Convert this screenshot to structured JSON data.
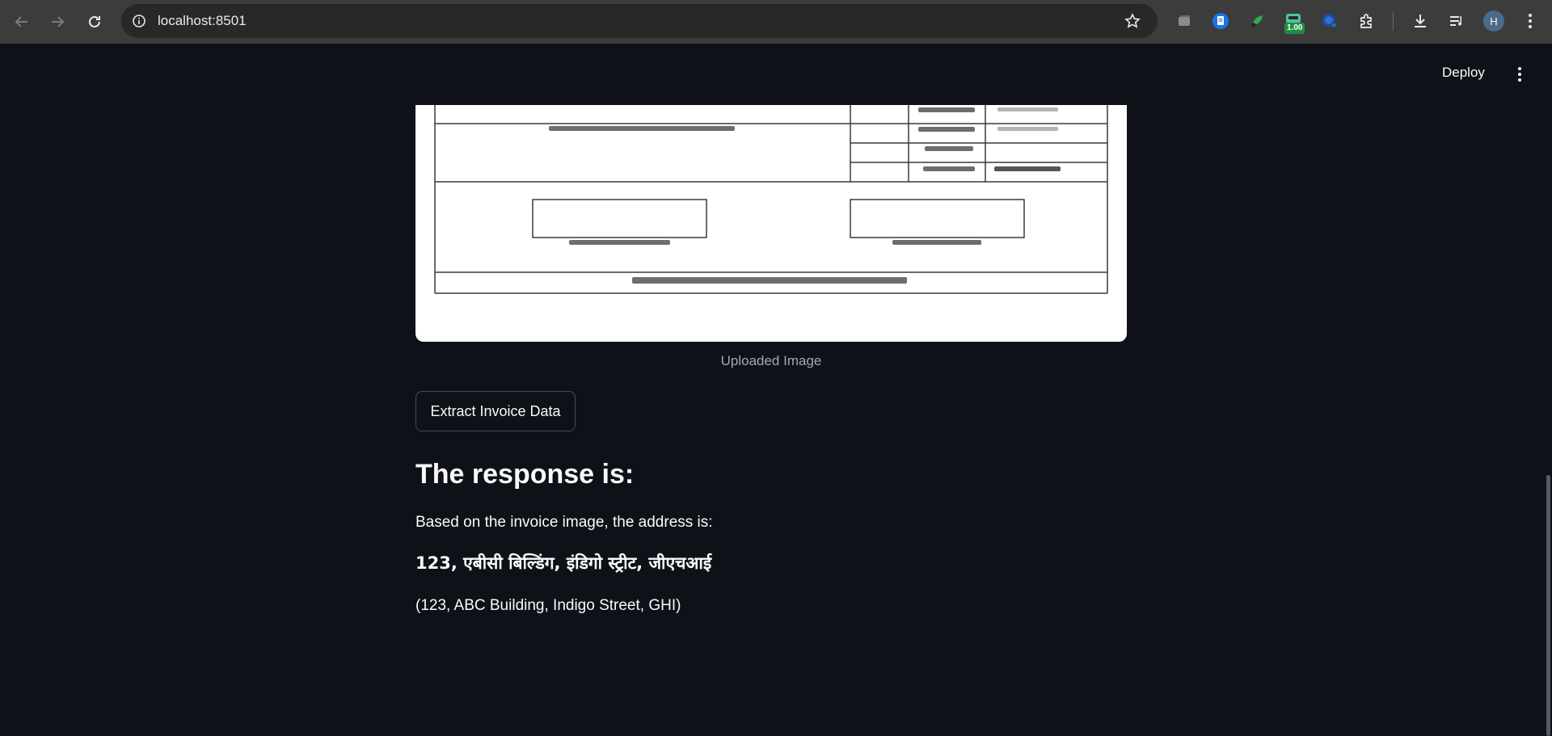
{
  "browser": {
    "url": "localhost:8501",
    "extension_badge": "1.00",
    "profile_initial": "H"
  },
  "header": {
    "deploy_label": "Deploy"
  },
  "main": {
    "image_caption": "Uploaded Image",
    "extract_button_label": "Extract Invoice Data",
    "response_heading": "The response is:",
    "response_intro": "Based on the invoice image, the address is:",
    "response_address": "123, एबीसी बिल्डिंग, इंडिगो स्ट्रीट, जीएचआई",
    "response_translation": "(123, ABC Building, Indigo Street, GHI)"
  },
  "colors": {
    "app_background": "#0e1117",
    "chrome_background": "#3c3c3c",
    "text": "#fafafa",
    "caption_text": "#a3a8b8"
  }
}
